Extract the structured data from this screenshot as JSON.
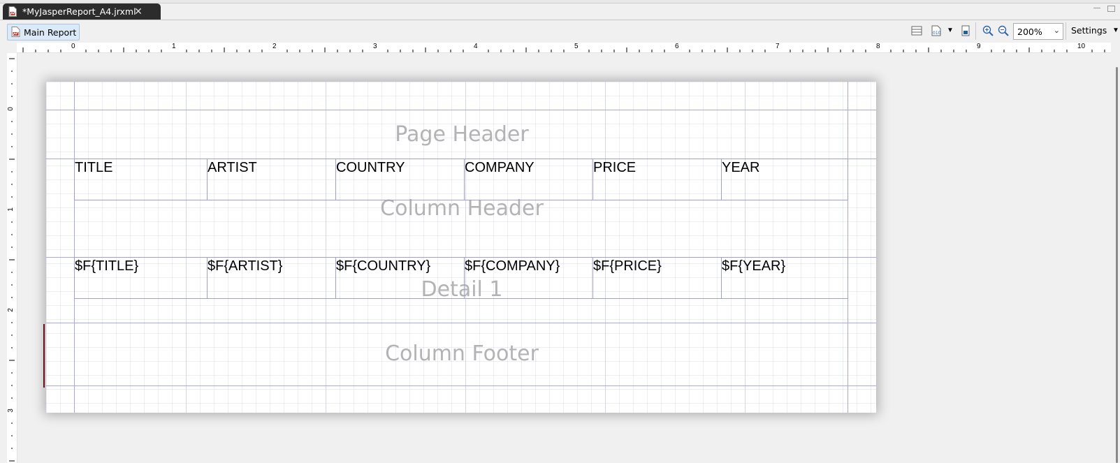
{
  "editor_tab": {
    "title": "*MyJasperReport_A4.jrxml",
    "close_icon": "close-icon"
  },
  "toolbar": {
    "main_report_label": "Main Report",
    "zoom_value": "200%",
    "settings_label": "Settings"
  },
  "rulers": {
    "horizontal_numbers": [
      "0",
      "1",
      "2",
      "3",
      "4",
      "5",
      "6",
      "7",
      "8",
      "9",
      "10"
    ],
    "vertical_numbers": [
      "0",
      "1",
      "2",
      "3"
    ]
  },
  "bands": {
    "page_header": "Page Header",
    "column_header": "Column Header",
    "detail": "Detail 1",
    "column_footer": "Column Footer"
  },
  "column_headers": [
    "TITLE",
    "ARTIST",
    "COUNTRY",
    "COMPANY",
    "PRICE",
    "YEAR"
  ],
  "detail_fields": [
    "$F{TITLE}",
    "$F{ARTIST}",
    "$F{COUNTRY}",
    "$F{COMPANY}",
    "$F{PRICE}",
    "$F{YEAR}"
  ],
  "colors": {
    "accent": "#2c2c2c",
    "band_label": "#b3b3b3",
    "band_line": "#a9a9dc"
  }
}
